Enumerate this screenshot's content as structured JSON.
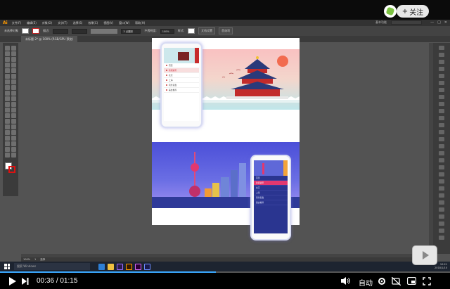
{
  "topbar": {
    "follow_label": "关注",
    "follow_plus": "+"
  },
  "illustrator": {
    "app_logo": "Ai",
    "menus": [
      "文件(F)",
      "编辑(E)",
      "对象(O)",
      "文字(T)",
      "选择(S)",
      "效果(C)",
      "视图(V)",
      "窗口(W)",
      "帮助(H)"
    ],
    "workspace": "基本功能",
    "control_bar": {
      "label": "未选择对象",
      "stroke_label": "描边:",
      "point_label": "3 点圆形",
      "opacity_label": "不透明度:",
      "opacity_value": "100%",
      "style_label": "样式:",
      "doc_setup_btn": "文档设置",
      "prefs_btn": "首选项"
    },
    "doc_tab": "未标题-2* @ 100% (RGB/GPU 预览)",
    "status": {
      "zoom": "100%",
      "artboard": "1",
      "tool": "选择"
    }
  },
  "artboard": {
    "colors": {
      "top_sky_top": "#f9c1c1",
      "top_ground": "#79c6cb",
      "bottom_sky": "#4b4fd8",
      "accent_red": "#d02a2a",
      "accent_blue": "#2f3a99"
    },
    "phone_left_menu": [
      "首页",
      "新闻资讯",
      "北京",
      "上海",
      "风景名胜",
      "美食推荐"
    ],
    "phone_right_menu": [
      "首页",
      "新闻资讯",
      "北京",
      "上海",
      "风景名胜",
      "美食推荐"
    ]
  },
  "taskbar": {
    "search_placeholder": "搜索 Windows",
    "tray_time": "10:21",
    "tray_date": "2018/1/10"
  },
  "player": {
    "current_time": "00:36",
    "separator": "/",
    "total_time": "01:15",
    "progress": 0.48,
    "auto_label": "自动"
  }
}
